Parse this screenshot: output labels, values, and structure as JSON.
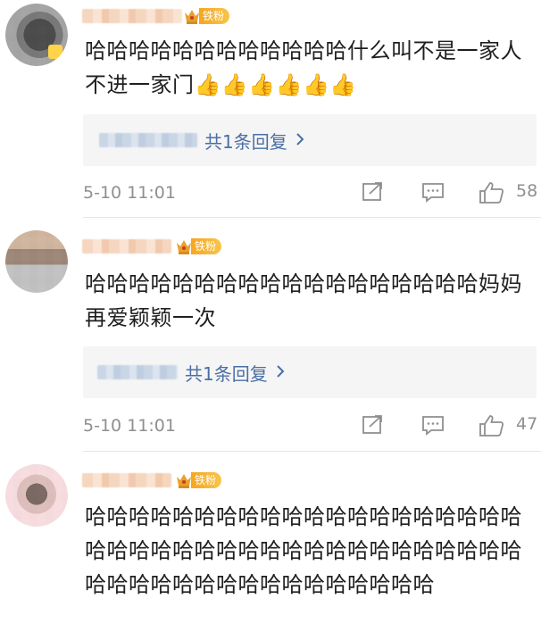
{
  "comments": [
    {
      "badge": "铁粉",
      "text": "哈哈哈哈哈哈哈哈哈哈哈哈什么叫不是一家人不进一家门",
      "thumbs": "👍👍👍👍👍👍",
      "reply_label": "共1条回复",
      "time": "5-10 11:01",
      "likes": "58"
    },
    {
      "badge": "铁粉",
      "text": "哈哈哈哈哈哈哈哈哈哈哈哈哈哈哈哈哈哈妈妈再爱颖颖一次",
      "thumbs": "",
      "reply_label": "共1条回复",
      "time": "5-10 11:01",
      "likes": "47"
    },
    {
      "badge": "铁粉",
      "text": "哈哈哈哈哈哈哈哈哈哈哈哈哈哈哈哈哈哈哈哈哈哈哈哈哈哈哈哈哈哈哈哈哈哈哈哈哈哈哈哈哈哈哈哈哈哈哈哈哈哈哈哈哈哈哈哈",
      "thumbs": "",
      "reply_label": "",
      "time": "",
      "likes": ""
    }
  ],
  "icons": {
    "repost": "repost-icon",
    "comment": "comment-icon",
    "like": "thumbs-up-icon",
    "fan_badge": "crown-badge-icon"
  },
  "colors": {
    "reply_link": "#4a6fa5",
    "badge": "#f6a623",
    "meta": "#8f8f8f"
  }
}
